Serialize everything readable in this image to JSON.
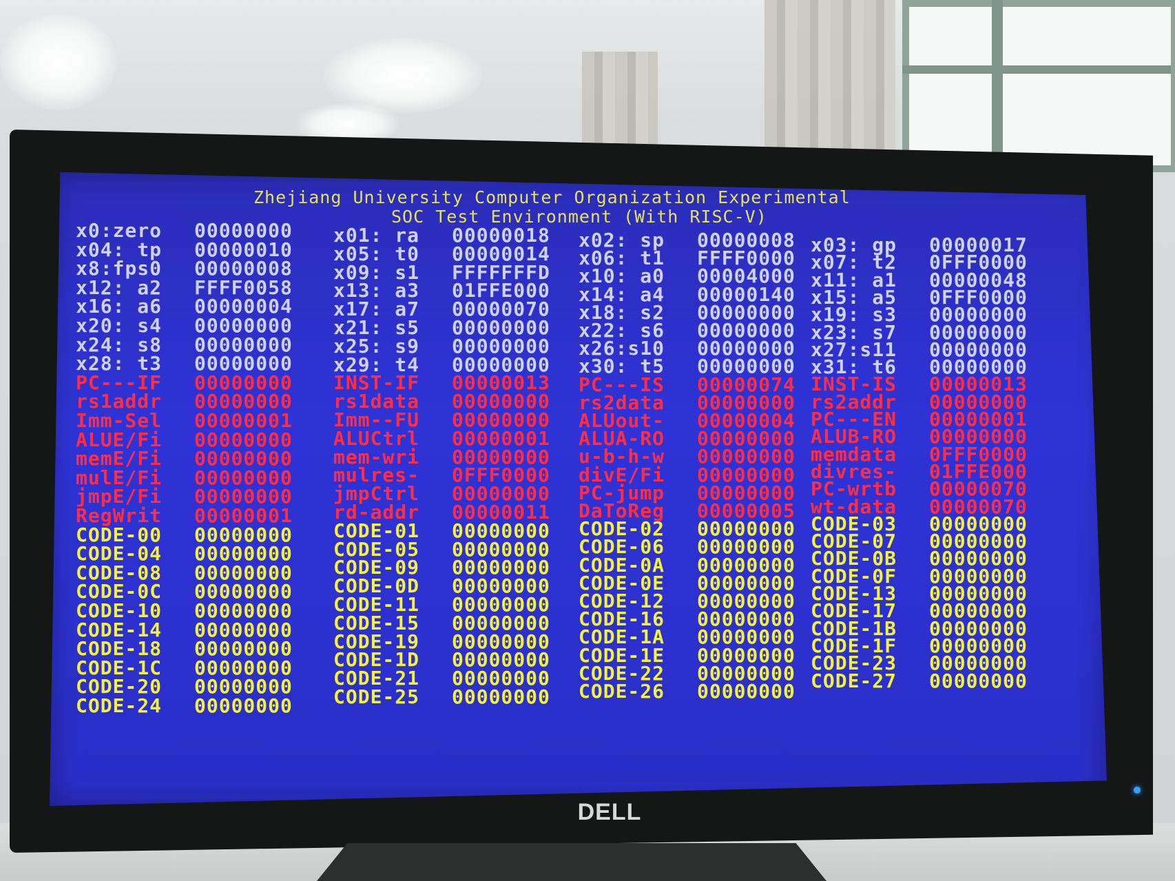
{
  "screen": {
    "title_line1": "Zhejiang University Computer Organization Experimental",
    "title_line2": "SOC Test Environment (With RISC-V)",
    "brand": "DELL"
  },
  "columns": [
    {
      "cells": [
        {
          "label": "x0:zero",
          "value": "00000000",
          "kind": "reg"
        },
        {
          "label": "x04: tp",
          "value": "00000010",
          "kind": "reg"
        },
        {
          "label": "x8:fps0",
          "value": "00000008",
          "kind": "reg"
        },
        {
          "label": "x12: a2",
          "value": "FFFF0058",
          "kind": "reg"
        },
        {
          "label": "x16: a6",
          "value": "00000004",
          "kind": "reg"
        },
        {
          "label": "x20: s4",
          "value": "00000000",
          "kind": "reg"
        },
        {
          "label": "x24: s8",
          "value": "00000000",
          "kind": "reg"
        },
        {
          "label": "x28: t3",
          "value": "00000000",
          "kind": "reg"
        },
        {
          "label": "PC---IF",
          "value": "00000000",
          "kind": "sig"
        },
        {
          "label": "rs1addr",
          "value": "00000000",
          "kind": "sig"
        },
        {
          "label": "Imm-Sel",
          "value": "00000001",
          "kind": "sig"
        },
        {
          "label": "ALUE/Fi",
          "value": "00000000",
          "kind": "sig"
        },
        {
          "label": "memE/Fi",
          "value": "00000000",
          "kind": "sig"
        },
        {
          "label": "mulE/Fi",
          "value": "00000000",
          "kind": "sig"
        },
        {
          "label": "jmpE/Fi",
          "value": "00000000",
          "kind": "sig"
        },
        {
          "label": "RegWrit",
          "value": "00000001",
          "kind": "sig"
        },
        {
          "label": "CODE-00",
          "value": "00000000",
          "kind": "code"
        },
        {
          "label": "CODE-04",
          "value": "00000000",
          "kind": "code"
        },
        {
          "label": "CODE-08",
          "value": "00000000",
          "kind": "code"
        },
        {
          "label": "CODE-0C",
          "value": "00000000",
          "kind": "code"
        },
        {
          "label": "CODE-10",
          "value": "00000000",
          "kind": "code"
        },
        {
          "label": "CODE-14",
          "value": "00000000",
          "kind": "code"
        },
        {
          "label": "CODE-18",
          "value": "00000000",
          "kind": "code"
        },
        {
          "label": "CODE-1C",
          "value": "00000000",
          "kind": "code"
        },
        {
          "label": "CODE-20",
          "value": "00000000",
          "kind": "code"
        },
        {
          "label": "CODE-24",
          "value": "00000000",
          "kind": "code"
        }
      ]
    },
    {
      "cells": [
        {
          "label": "x01: ra",
          "value": "00000018",
          "kind": "reg"
        },
        {
          "label": "x05: t0",
          "value": "00000014",
          "kind": "reg"
        },
        {
          "label": "x09: s1",
          "value": "FFFFFFFD",
          "kind": "reg"
        },
        {
          "label": "x13: a3",
          "value": "01FFE000",
          "kind": "reg"
        },
        {
          "label": "x17: a7",
          "value": "00000070",
          "kind": "reg"
        },
        {
          "label": "x21: s5",
          "value": "00000000",
          "kind": "reg"
        },
        {
          "label": "x25: s9",
          "value": "00000000",
          "kind": "reg"
        },
        {
          "label": "x29: t4",
          "value": "00000000",
          "kind": "reg"
        },
        {
          "label": "INST-IF",
          "value": "00000013",
          "kind": "sig"
        },
        {
          "label": "rs1data",
          "value": "00000000",
          "kind": "sig"
        },
        {
          "label": "Imm--FU",
          "value": "00000000",
          "kind": "sig"
        },
        {
          "label": "ALUCtrl",
          "value": "00000001",
          "kind": "sig"
        },
        {
          "label": "mem-wri",
          "value": "00000000",
          "kind": "sig"
        },
        {
          "label": "mulres-",
          "value": "0FFF0000",
          "kind": "sig"
        },
        {
          "label": "jmpCtrl",
          "value": "00000000",
          "kind": "sig"
        },
        {
          "label": "rd-addr",
          "value": "00000011",
          "kind": "sig"
        },
        {
          "label": "CODE-01",
          "value": "00000000",
          "kind": "code"
        },
        {
          "label": "CODE-05",
          "value": "00000000",
          "kind": "code"
        },
        {
          "label": "CODE-09",
          "value": "00000000",
          "kind": "code"
        },
        {
          "label": "CODE-0D",
          "value": "00000000",
          "kind": "code"
        },
        {
          "label": "CODE-11",
          "value": "00000000",
          "kind": "code"
        },
        {
          "label": "CODE-15",
          "value": "00000000",
          "kind": "code"
        },
        {
          "label": "CODE-19",
          "value": "00000000",
          "kind": "code"
        },
        {
          "label": "CODE-1D",
          "value": "00000000",
          "kind": "code"
        },
        {
          "label": "CODE-21",
          "value": "00000000",
          "kind": "code"
        },
        {
          "label": "CODE-25",
          "value": "00000000",
          "kind": "code"
        }
      ]
    },
    {
      "cells": [
        {
          "label": "x02: sp",
          "value": "00000008",
          "kind": "reg"
        },
        {
          "label": "x06: t1",
          "value": "FFFF0000",
          "kind": "reg"
        },
        {
          "label": "x10: a0",
          "value": "00004000",
          "kind": "reg"
        },
        {
          "label": "x14: a4",
          "value": "00000140",
          "kind": "reg"
        },
        {
          "label": "x18: s2",
          "value": "00000000",
          "kind": "reg"
        },
        {
          "label": "x22: s6",
          "value": "00000000",
          "kind": "reg"
        },
        {
          "label": "x26:s10",
          "value": "00000000",
          "kind": "reg"
        },
        {
          "label": "x30: t5",
          "value": "00000000",
          "kind": "reg"
        },
        {
          "label": "PC---IS",
          "value": "00000074",
          "kind": "sig"
        },
        {
          "label": "rs2data",
          "value": "00000000",
          "kind": "sig"
        },
        {
          "label": "ALUout-",
          "value": "00000004",
          "kind": "sig"
        },
        {
          "label": "ALUA-RO",
          "value": "00000000",
          "kind": "sig"
        },
        {
          "label": "u-b-h-w",
          "value": "00000000",
          "kind": "sig"
        },
        {
          "label": "divE/Fi",
          "value": "00000000",
          "kind": "sig"
        },
        {
          "label": "PC-jump",
          "value": "00000000",
          "kind": "sig"
        },
        {
          "label": "DaToReg",
          "value": "00000005",
          "kind": "sig"
        },
        {
          "label": "CODE-02",
          "value": "00000000",
          "kind": "code"
        },
        {
          "label": "CODE-06",
          "value": "00000000",
          "kind": "code"
        },
        {
          "label": "CODE-0A",
          "value": "00000000",
          "kind": "code"
        },
        {
          "label": "CODE-0E",
          "value": "00000000",
          "kind": "code"
        },
        {
          "label": "CODE-12",
          "value": "00000000",
          "kind": "code"
        },
        {
          "label": "CODE-16",
          "value": "00000000",
          "kind": "code"
        },
        {
          "label": "CODE-1A",
          "value": "00000000",
          "kind": "code"
        },
        {
          "label": "CODE-1E",
          "value": "00000000",
          "kind": "code"
        },
        {
          "label": "CODE-22",
          "value": "00000000",
          "kind": "code"
        },
        {
          "label": "CODE-26",
          "value": "00000000",
          "kind": "code"
        }
      ]
    },
    {
      "cells": [
        {
          "label": "x03: gp",
          "value": "00000017",
          "kind": "reg"
        },
        {
          "label": "x07: t2",
          "value": "0FFF0000",
          "kind": "reg"
        },
        {
          "label": "x11: a1",
          "value": "00000048",
          "kind": "reg"
        },
        {
          "label": "x15: a5",
          "value": "0FFF0000",
          "kind": "reg"
        },
        {
          "label": "x19: s3",
          "value": "00000000",
          "kind": "reg"
        },
        {
          "label": "x23: s7",
          "value": "00000000",
          "kind": "reg"
        },
        {
          "label": "x27:s11",
          "value": "00000000",
          "kind": "reg"
        },
        {
          "label": "x31: t6",
          "value": "00000000",
          "kind": "reg"
        },
        {
          "label": "INST-IS",
          "value": "00000013",
          "kind": "sig"
        },
        {
          "label": "rs2addr",
          "value": "00000000",
          "kind": "sig"
        },
        {
          "label": "PC---EN",
          "value": "00000001",
          "kind": "sig"
        },
        {
          "label": "ALUB-RO",
          "value": "00000000",
          "kind": "sig"
        },
        {
          "label": "memdata",
          "value": "0FFF0000",
          "kind": "sig"
        },
        {
          "label": "divres-",
          "value": "01FFE000",
          "kind": "sig"
        },
        {
          "label": "PC-wrtb",
          "value": "00000070",
          "kind": "sig"
        },
        {
          "label": "wt-data",
          "value": "00000070",
          "kind": "sig"
        },
        {
          "label": "CODE-03",
          "value": "00000000",
          "kind": "code"
        },
        {
          "label": "CODE-07",
          "value": "00000000",
          "kind": "code"
        },
        {
          "label": "CODE-0B",
          "value": "00000000",
          "kind": "code"
        },
        {
          "label": "CODE-0F",
          "value": "00000000",
          "kind": "code"
        },
        {
          "label": "CODE-13",
          "value": "00000000",
          "kind": "code"
        },
        {
          "label": "CODE-17",
          "value": "00000000",
          "kind": "code"
        },
        {
          "label": "CODE-1B",
          "value": "00000000",
          "kind": "code"
        },
        {
          "label": "CODE-1F",
          "value": "00000000",
          "kind": "code"
        },
        {
          "label": "CODE-23",
          "value": "00000000",
          "kind": "code"
        },
        {
          "label": "CODE-27",
          "value": "00000000",
          "kind": "code"
        }
      ]
    }
  ],
  "colors": {
    "register_text": "#cfd2ec",
    "signal_text": "#ff2e45",
    "code_text": "#f4f23e",
    "title_text": "#e8e25a",
    "screen_background": "#2f33d6"
  }
}
